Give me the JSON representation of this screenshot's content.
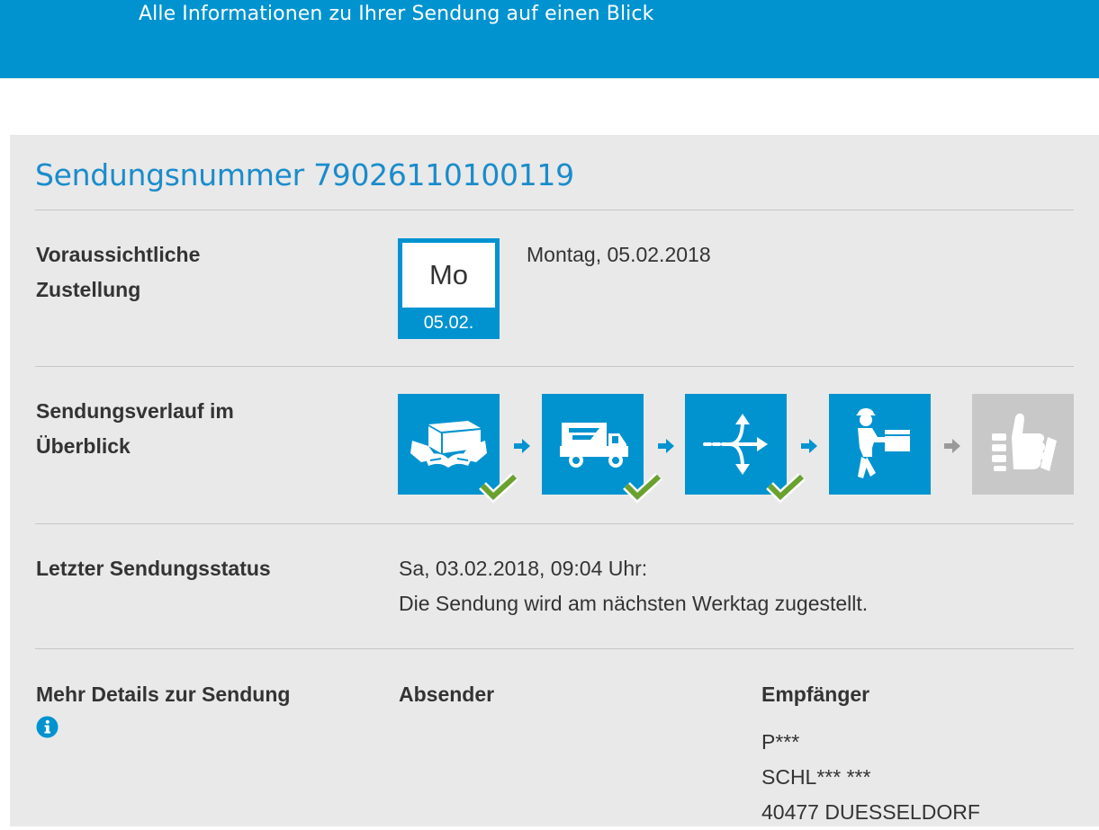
{
  "header": {
    "subtitle": "Alle Informationen zu Ihrer Sendung auf einen Blick"
  },
  "shipment": {
    "title": "Sendungsnummer 79026110100119"
  },
  "delivery": {
    "label_line1": "Voraussichtliche",
    "label_line2": "Zustellung",
    "calendar_day": "Mo",
    "calendar_date": "05.02.",
    "date_text": "Montag, 05.02.2018"
  },
  "progress": {
    "label_line1": "Sendungsverlauf im",
    "label_line2": "Überblick",
    "steps": [
      {
        "icon": "parcel-handover-icon",
        "done": true
      },
      {
        "icon": "delivery-truck-icon",
        "done": true
      },
      {
        "icon": "sorting-split-icon",
        "done": true
      },
      {
        "icon": "courier-carrying-parcel-icon",
        "done": false
      },
      {
        "icon": "thumbs-up-icon",
        "done": false
      }
    ],
    "colors": {
      "active": "#0093d0",
      "inactive": "#c8c8c8",
      "check": "#6aa12f"
    }
  },
  "status": {
    "label": "Letzter Sendungsstatus",
    "line1": "Sa, 03.02.2018, 09:04 Uhr:",
    "line2": "Die Sendung wird am nächsten Werktag zugestellt."
  },
  "details": {
    "label": "Mehr Details zur Sendung",
    "info_icon": "info-icon",
    "sender_heading": "Absender",
    "recipient_heading": "Empfänger",
    "recipient_line1": "P***",
    "recipient_line2": "SCHL*** ***",
    "recipient_line3": "40477 DUESSELDORF"
  }
}
